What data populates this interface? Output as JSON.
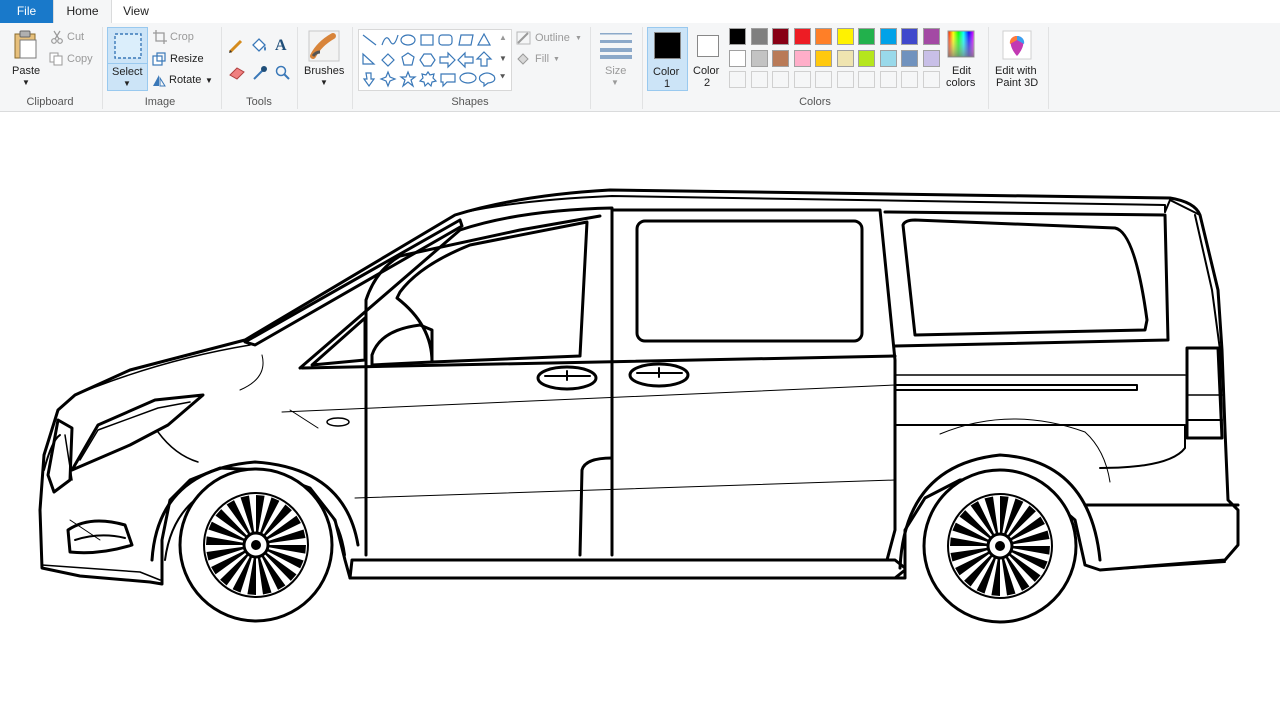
{
  "tabs": {
    "file": "File",
    "home": "Home",
    "view": "View"
  },
  "clipboard": {
    "paste": "Paste",
    "cut": "Cut",
    "copy": "Copy",
    "group": "Clipboard"
  },
  "image": {
    "select": "Select",
    "crop": "Crop",
    "resize": "Resize",
    "rotate": "Rotate",
    "group": "Image"
  },
  "tools": {
    "group": "Tools",
    "text_glyph": "A"
  },
  "brushes": {
    "label": "Brushes"
  },
  "shapes": {
    "outline": "Outline",
    "fill": "Fill",
    "group": "Shapes"
  },
  "size": {
    "label": "Size"
  },
  "colors": {
    "color1_line1": "Color",
    "color1_line2": "1",
    "color2_line1": "Color",
    "color2_line2": "2",
    "edit_line1": "Edit",
    "edit_line2": "colors",
    "group": "Colors",
    "color1_value": "#000000",
    "color2_value": "#ffffff",
    "palette_row1": [
      "#000000",
      "#7f7f7f",
      "#880015",
      "#ed1c24",
      "#ff7f27",
      "#fff200",
      "#22b14c",
      "#00a2e8",
      "#3f48cc",
      "#a349a4"
    ],
    "palette_row2": [
      "#ffffff",
      "#c3c3c3",
      "#b97a57",
      "#ffaec9",
      "#ffc90e",
      "#efe4b0",
      "#b5e61d",
      "#99d9ea",
      "#7092be",
      "#c8bfe7"
    ]
  },
  "paint3d": {
    "line1": "Edit with",
    "line2": "Paint 3D"
  }
}
